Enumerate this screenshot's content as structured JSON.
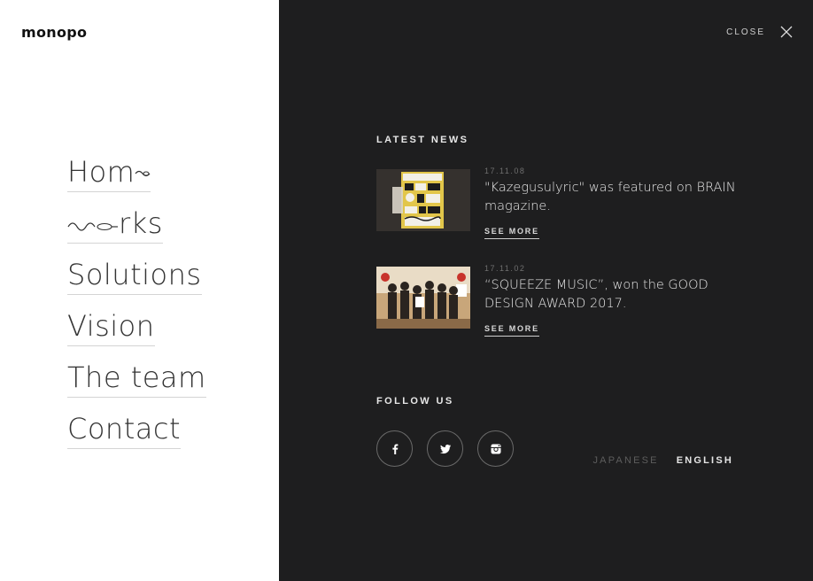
{
  "brand": {
    "logo": "monopo"
  },
  "nav": {
    "items": [
      {
        "label": "Home",
        "label_prefix": "Hom"
      },
      {
        "label": "Works",
        "label_suffix": "rks"
      },
      {
        "label": "Solutions"
      },
      {
        "label": "Vision"
      },
      {
        "label": "The team"
      },
      {
        "label": "Contact"
      }
    ]
  },
  "header": {
    "close_label": "CLOSE"
  },
  "news": {
    "title": "LATEST NEWS",
    "items": [
      {
        "date": "17.11.08",
        "text": "\"Kazegusulyric\" was featured on BRAIN magazine.",
        "link": "SEE MORE"
      },
      {
        "date": "17.11.02",
        "text": "“SQUEEZE MUSIC”, won the GOOD DESIGN AWARD 2017.",
        "link": "SEE MORE"
      }
    ]
  },
  "follow": {
    "title": "FOLLOW US",
    "icons": [
      "facebook-icon",
      "twitter-icon",
      "instagram-icon"
    ]
  },
  "language": {
    "japanese": "JAPANESE",
    "english": "ENGLISH",
    "active": "ENGLISH"
  },
  "colors": {
    "panel_dark": "#1e1e1f",
    "panel_light": "#ffffff",
    "muted": "#5d5d5d"
  }
}
